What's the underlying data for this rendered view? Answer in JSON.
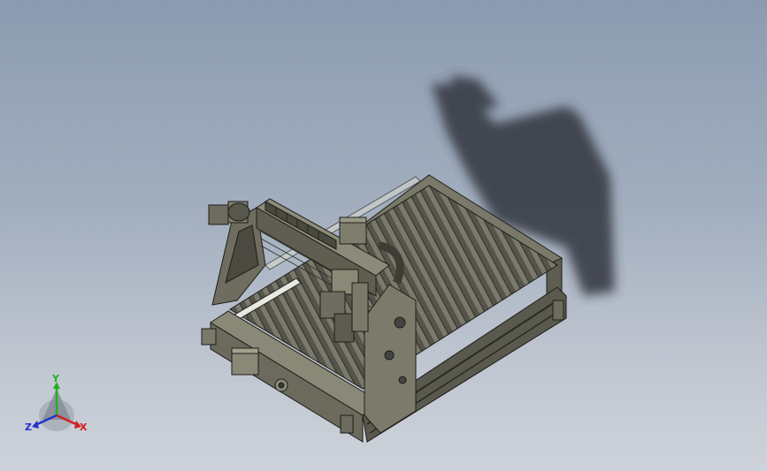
{
  "viewport": {
    "background_top": "#8c9bb0",
    "background_bottom": "#cdd2da"
  },
  "model": {
    "name_hint": "cnc-router-machine",
    "body_color": "#5b5a4e",
    "edge_color": "#1e1e1a",
    "shadow_color": "#3a3d44"
  },
  "triad": {
    "x_label": "X",
    "y_label": "Y",
    "z_label": "Z",
    "x_color": "#d11f1f",
    "y_color": "#22b022",
    "z_color": "#2233cc"
  }
}
